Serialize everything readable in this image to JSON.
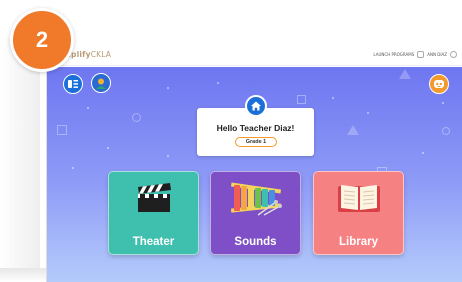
{
  "step_badge": {
    "number": "2"
  },
  "app": {
    "logo_prefix": "Amplify",
    "logo_suffix": "CKLA",
    "launch_programs": "LAUNCH PROGRAMS",
    "user_name": "ANN DIAZ"
  },
  "greeting": {
    "text": "Hello Teacher Diaz!",
    "grade": "Grade 1"
  },
  "tiles": [
    {
      "label": "Theater",
      "color": "#3fbfae",
      "icon": "clapperboard-icon"
    },
    {
      "label": "Sounds",
      "color": "#7e4fc6",
      "icon": "xylophone-icon"
    },
    {
      "label": "Library",
      "color": "#f58183",
      "icon": "open-book-icon"
    }
  ],
  "colors": {
    "accent_orange": "#f07a2a",
    "primary_blue": "#1a6fd8",
    "background_top": "#6e76f0",
    "background_bottom": "#b3cbfb"
  }
}
